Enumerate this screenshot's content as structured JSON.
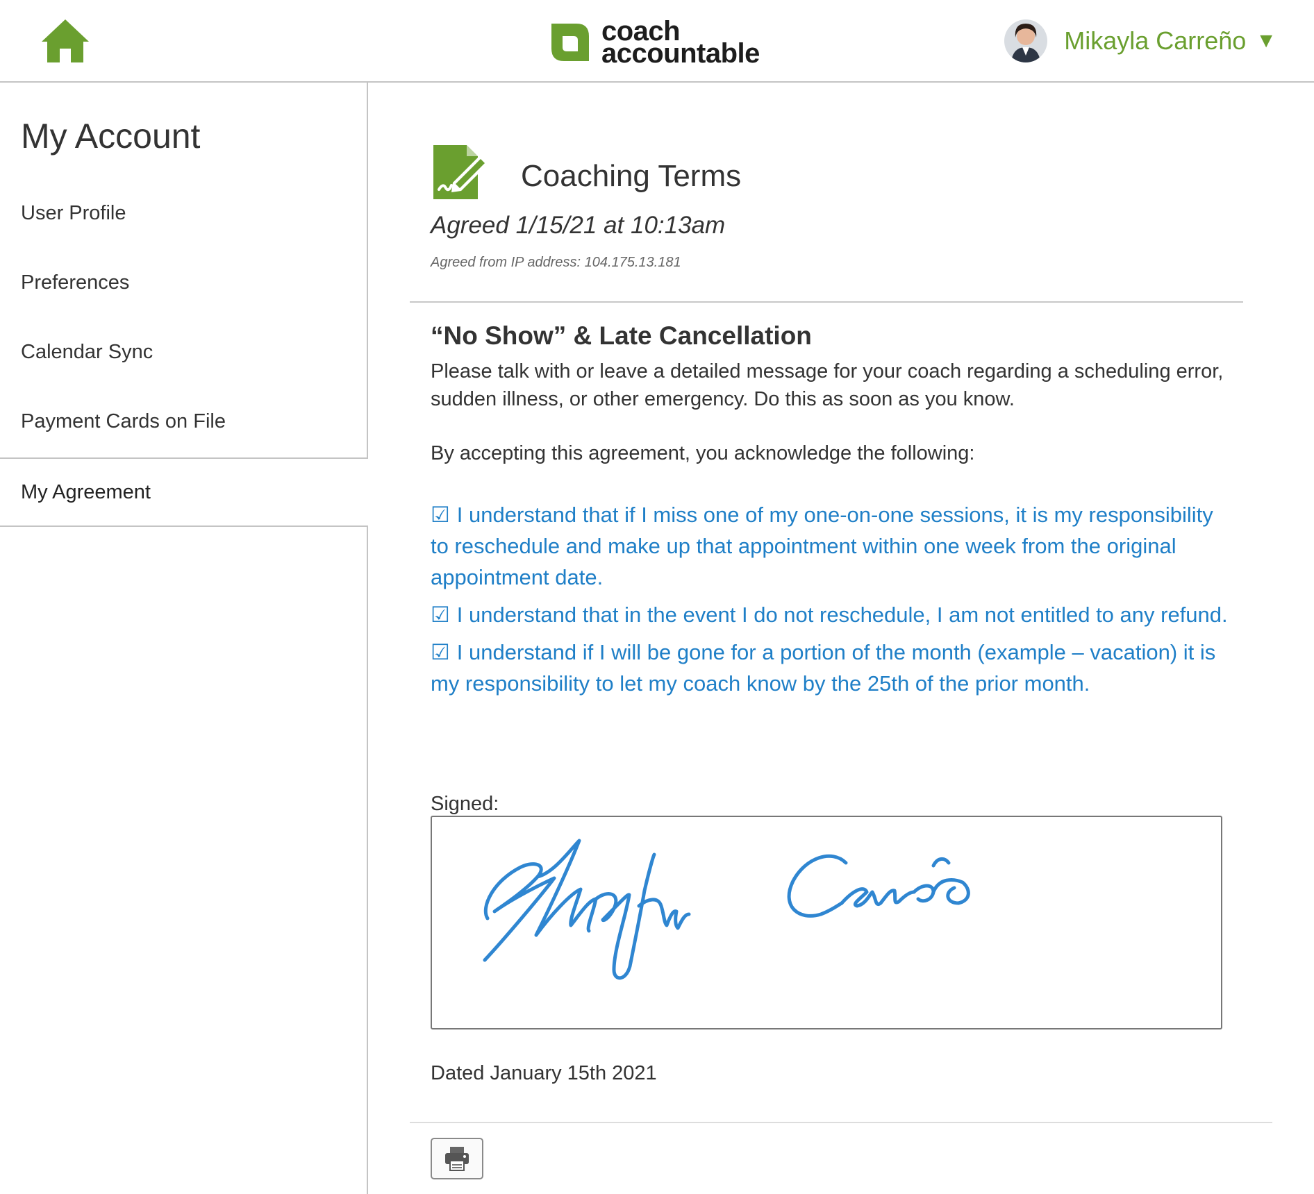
{
  "header": {
    "home_icon": "home-icon",
    "logo": {
      "line1": "coach",
      "line2": "accountable"
    },
    "user": {
      "name": "Mikayla Carreño",
      "caret": "▼",
      "avatar_icon": "user-avatar"
    }
  },
  "sidebar": {
    "title": "My Account",
    "items": [
      {
        "label": "User Profile"
      },
      {
        "label": "Preferences"
      },
      {
        "label": "Calendar Sync"
      },
      {
        "label": "Payment Cards on File"
      },
      {
        "label": "My Agreement",
        "selected": true
      }
    ]
  },
  "agreement": {
    "icon": "document-signature-icon",
    "title": "Coaching Terms",
    "agreed": "Agreed 1/15/21 at 10:13am",
    "ip": "Agreed from IP address: 104.175.13.181",
    "heading": "“No Show” & Late Cancellation",
    "paragraph1": "Please talk with or leave a detailed message for your coach regarding a scheduling error, sudden illness, or other emergency.  Do this as soon as you know.",
    "paragraph2": "By accepting this agreement, you acknowledge the following:",
    "check_glyph": "☑",
    "checks": [
      "I understand that if I miss one of my one-on-one sessions, it is my responsibility to reschedule and make up that appointment within one week from the original appointment date.",
      "I understand that in the event I do not reschedule, I am not entitled to any refund.",
      "I understand if I will be gone for a portion of the month (example – vacation) it is my responsibility to let my coach know by the 25th of the prior month."
    ],
    "signed_label": "Signed:",
    "signature_text": "Mikayla Carreño",
    "dated": "Dated January 15th 2021",
    "print_icon": "printer-icon"
  },
  "colors": {
    "brand_green": "#6a9f2f",
    "link_blue": "#1f7fc7",
    "signature_blue": "#2f86d1",
    "border_gray": "#c4c4c4"
  }
}
